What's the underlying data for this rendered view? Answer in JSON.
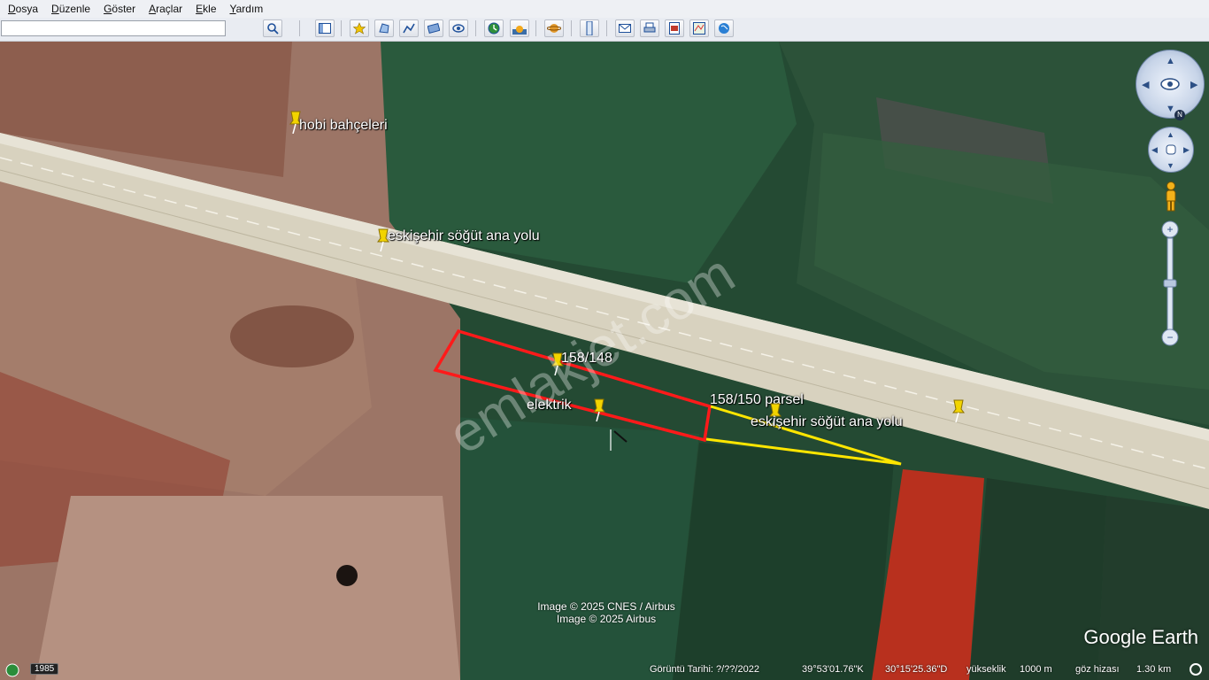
{
  "menu": [
    "Dosya",
    "Düzenle",
    "Göster",
    "Araçlar",
    "Ekle",
    "Yardım"
  ],
  "menu_underline": [
    "D",
    "D",
    "G",
    "A",
    "E",
    "Y"
  ],
  "search": {
    "value": "",
    "placeholder": ""
  },
  "toolbar_icons": [
    "search-icon",
    "sidebar-toggle-icon",
    "placemark-icon",
    "polygon-icon",
    "path-icon",
    "image-overlay-icon",
    "record-tour-icon",
    "historical-imagery-icon",
    "sunlight-icon",
    "planets-icon",
    "ruler-icon",
    "email-icon",
    "print-icon",
    "save-image-icon",
    "view-in-maps-icon",
    "earth-icon"
  ],
  "placemarks": {
    "hobi": "hobi bahçeleri",
    "road_top": "eskişehir söğüt ana yolu",
    "parcel_148": "158/148",
    "elektrik": "elektrik",
    "parcel_150": "158/150 parsel",
    "road_right": "eskişehir söğüt ana yolu"
  },
  "watermark": "emlakjet.com",
  "attribution": [
    "Image © 2025 CNES / Airbus",
    "Image © 2025 Airbus"
  ],
  "brand": "Google Earth",
  "north_label": "N",
  "statusbar": {
    "tour_year": "1985",
    "imagery_date": "Görüntü Tarihi: ?/??/2022",
    "lat": "39°53'01.76\"K",
    "lon": "30°15'25.36\"D",
    "elev_label": "yükseklik",
    "elev_value": "1000 m",
    "eye_label": "göz hizası",
    "eye_value": "1.30 km"
  },
  "colors": {
    "parcel_outline": "#ff1a1a",
    "measure_line": "#ffe600",
    "pin": "#f2d400",
    "road": "#d8d2bf"
  }
}
